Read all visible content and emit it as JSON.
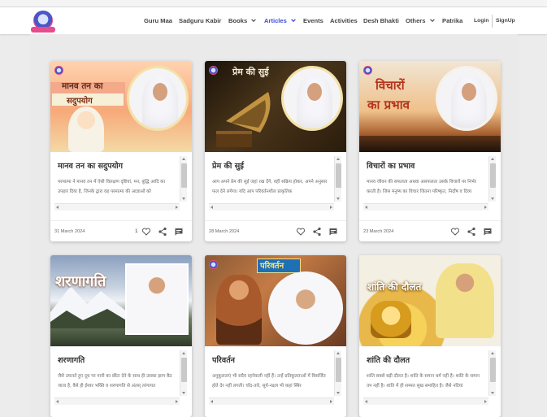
{
  "nav": {
    "logo_icon": "organization-logo",
    "items": [
      {
        "label": "Guru Maa"
      },
      {
        "label": "Sadguru Kabir"
      },
      {
        "label": "Books",
        "has_dropdown": true
      },
      {
        "label": "Articles",
        "has_dropdown": true,
        "active": true
      },
      {
        "label": "Events"
      },
      {
        "label": "Activities"
      },
      {
        "label": "Desh Bhakti"
      },
      {
        "label": "Others",
        "has_dropdown": true
      },
      {
        "label": "Patrika"
      }
    ],
    "login_label": "Login",
    "signup_label": "SignUp",
    "active_color": "#3b4bd6"
  },
  "cards": [
    {
      "banner_text": [
        "मानव तन का",
        "सदुपयोग"
      ],
      "title": "मानव तन का सदुपयोग",
      "excerpt": "परमात्मा ने मानव तन में ऐसी विलक्षण दृष्टियां, मन, बुद्धि आदि का उपहार दिया है, जिनके द्वारा वह परमात्मा की आज्ञाओं को",
      "date": "31 March 2024",
      "likes": "1",
      "theme": "#f4b08a"
    },
    {
      "banner_text": [
        "प्रेम की सुई"
      ],
      "title": "प्रेम की सुई",
      "excerpt": "आप अपने प्रेम की सुई जहां रख देंगे, वहीं सक्रिय होकर, अपने अनुसार फल देने लगेगा। यदि आप परिवर्तनशील प्राकृतिक",
      "date": "28 March 2024",
      "likes": "",
      "theme": "#3a2a14"
    },
    {
      "banner_text": [
        "विचारों",
        "का प्रभाव"
      ],
      "title": "विचारों का प्रभाव",
      "excerpt": "मानव जीवन की सफलता अथवा असफलता उसके विचारों पर निर्भर करती है। जिस मनुष्य का विचार जितना परिष्कृत, निर्दोष व दिव्य",
      "date": "23 March 2024",
      "likes": "",
      "theme": "#c9432a"
    },
    {
      "banner_text": [
        "शरणागति"
      ],
      "title": "शरणागति",
      "excerpt": "जैसे उफनते हुए दूध पर पानी का छींटा देने के साथ ही उसका झाग बैठ जाता है, वैसे ही ईश्वर भक्ति व शरणागति से अंतस् तरंगायत",
      "date": "",
      "likes": "",
      "theme": "#8a9db7"
    },
    {
      "banner_text": [
        "परिवर्तन"
      ],
      "title": "परिवर्तन",
      "excerpt": "अनुकूलताएं भी सदैव रहनेवाली नहीं हैं। उन्हें प्रतिकूलताओं में विसर्जित होते देर नहीं लगती। चाँद-तारे, सूर्य-नक्षत्र भी कहां स्थिर",
      "date": "",
      "likes": "",
      "theme": "#b5633a"
    },
    {
      "banner_text": [
        "शांति की दौलत"
      ],
      "title": "शांति की दौलत",
      "excerpt": "शांति सबसे बड़ी दौलत है। शांति के समान धर्म नहीं है। शांति के समान तप नहीं है। शांति में ही समस्त सुख समाहित है। जैसे नदियां",
      "date": "",
      "likes": "",
      "theme": "#e5c24c"
    }
  ]
}
